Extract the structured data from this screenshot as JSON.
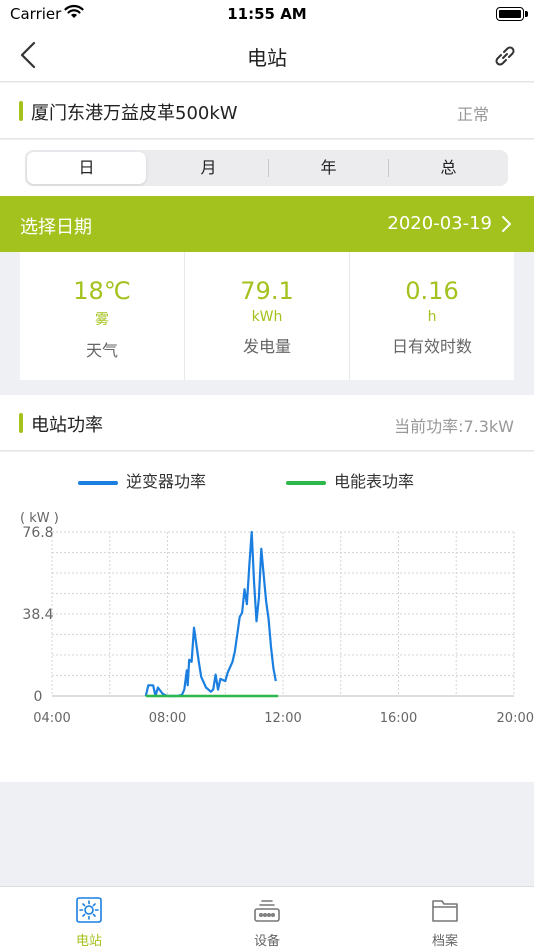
{
  "status_bar": {
    "carrier": "Carrier",
    "time": "11:55 AM"
  },
  "nav": {
    "title": "电站"
  },
  "station": {
    "name": "厦门东港万益皮革500kW",
    "status": "正常"
  },
  "segment": {
    "items": [
      "日",
      "月",
      "年",
      "总"
    ],
    "active_index": 0
  },
  "date_bar": {
    "label": "选择日期",
    "date": "2020-03-19"
  },
  "stats": [
    {
      "value": "18℃",
      "unit": "雾",
      "caption": "天气"
    },
    {
      "value": "79.1",
      "unit": "kWh",
      "caption": "发电量"
    },
    {
      "value": "0.16",
      "unit": "h",
      "caption": "日有效时数"
    }
  ],
  "power": {
    "title": "电站功率",
    "current": "当前功率:7.3kW"
  },
  "colors": {
    "accent": "#a3c21d",
    "inverter": "#1a7fe0",
    "meter": "#2db84d"
  },
  "chart_data": {
    "type": "line",
    "ylabel": "( kW )",
    "ylim": [
      0,
      76.8
    ],
    "y_ticks": [
      "76.8",
      "38.4",
      "0"
    ],
    "x_ticks": [
      "04:00",
      "08:00",
      "12:00",
      "16:00",
      "20:00"
    ],
    "xlim": [
      "04:00",
      "20:00"
    ],
    "grid": true,
    "legend": "top",
    "series": [
      {
        "name": "逆变器功率",
        "color": "#1a7fe0",
        "points": [
          [
            "07:15",
            0
          ],
          [
            "07:20",
            5
          ],
          [
            "07:30",
            5
          ],
          [
            "07:35",
            0
          ],
          [
            "07:40",
            4
          ],
          [
            "07:50",
            1
          ],
          [
            "08:00",
            0
          ],
          [
            "08:20",
            0
          ],
          [
            "08:30",
            0.5
          ],
          [
            "08:35",
            3
          ],
          [
            "08:40",
            12
          ],
          [
            "08:42",
            5
          ],
          [
            "08:45",
            17
          ],
          [
            "08:50",
            16
          ],
          [
            "08:55",
            32
          ],
          [
            "09:00",
            24
          ],
          [
            "09:05",
            16
          ],
          [
            "09:10",
            9
          ],
          [
            "09:20",
            4
          ],
          [
            "09:25",
            3
          ],
          [
            "09:30",
            2
          ],
          [
            "09:35",
            3
          ],
          [
            "09:40",
            10
          ],
          [
            "09:45",
            3
          ],
          [
            "09:50",
            8
          ],
          [
            "10:00",
            7
          ],
          [
            "10:05",
            11
          ],
          [
            "10:15",
            16
          ],
          [
            "10:20",
            21
          ],
          [
            "10:25",
            29
          ],
          [
            "10:30",
            37
          ],
          [
            "10:35",
            39
          ],
          [
            "10:40",
            50
          ],
          [
            "10:45",
            43
          ],
          [
            "10:50",
            61
          ],
          [
            "10:55",
            76.8
          ],
          [
            "11:00",
            53
          ],
          [
            "11:05",
            35
          ],
          [
            "11:10",
            46
          ],
          [
            "11:15",
            69
          ],
          [
            "11:20",
            56
          ],
          [
            "11:25",
            44
          ],
          [
            "11:30",
            36
          ],
          [
            "11:35",
            23
          ],
          [
            "11:40",
            13
          ],
          [
            "11:45",
            7
          ]
        ]
      },
      {
        "name": "电能表功率",
        "color": "#2db84d",
        "points": [
          [
            "07:15",
            0
          ],
          [
            "11:50",
            0
          ]
        ]
      }
    ]
  },
  "tabs": [
    {
      "label": "电站",
      "icon": "sun-icon",
      "active": true
    },
    {
      "label": "设备",
      "icon": "device-icon",
      "active": false
    },
    {
      "label": "档案",
      "icon": "folder-icon",
      "active": false
    }
  ]
}
